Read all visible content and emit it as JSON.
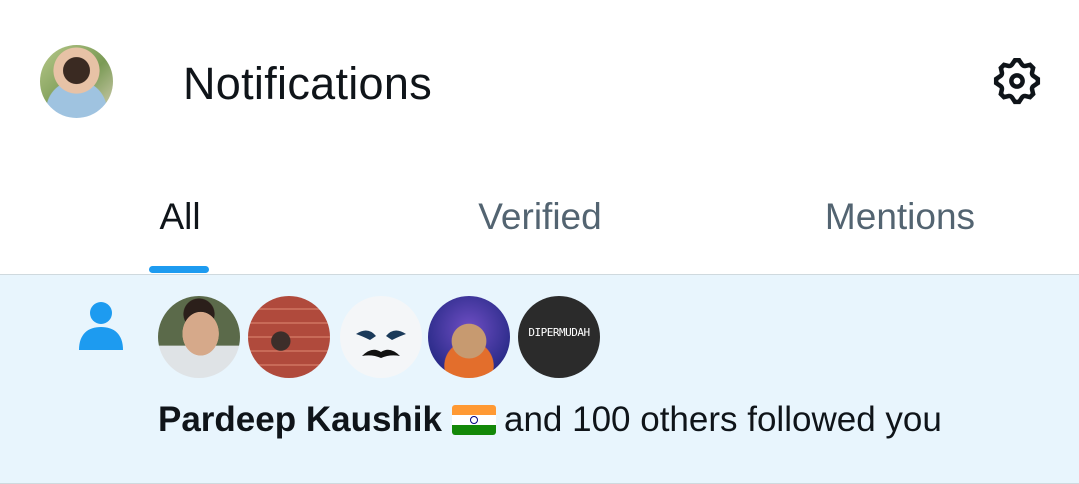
{
  "header": {
    "title": "Notifications",
    "avatar_icon": "user-avatar",
    "settings_icon": "gear-icon"
  },
  "tabs": [
    {
      "label": "All",
      "active": true
    },
    {
      "label": "Verified",
      "active": false
    },
    {
      "label": "Mentions",
      "active": false
    }
  ],
  "notification": {
    "icon": "person-icon",
    "follower_avatars": [
      "follower-avatar-1",
      "follower-avatar-2",
      "follower-avatar-3",
      "follower-avatar-4",
      "follower-avatar-5"
    ],
    "follower_5_text": "DIPERMUDAH",
    "name": "Pardeep Kaushik",
    "flag_emoji": "🇮🇳",
    "message": "and 100 others followed you"
  },
  "colors": {
    "accent": "#1d9bf0",
    "highlight_bg": "#e8f5fd",
    "muted_text": "#536471",
    "primary_text": "#0f1419"
  }
}
